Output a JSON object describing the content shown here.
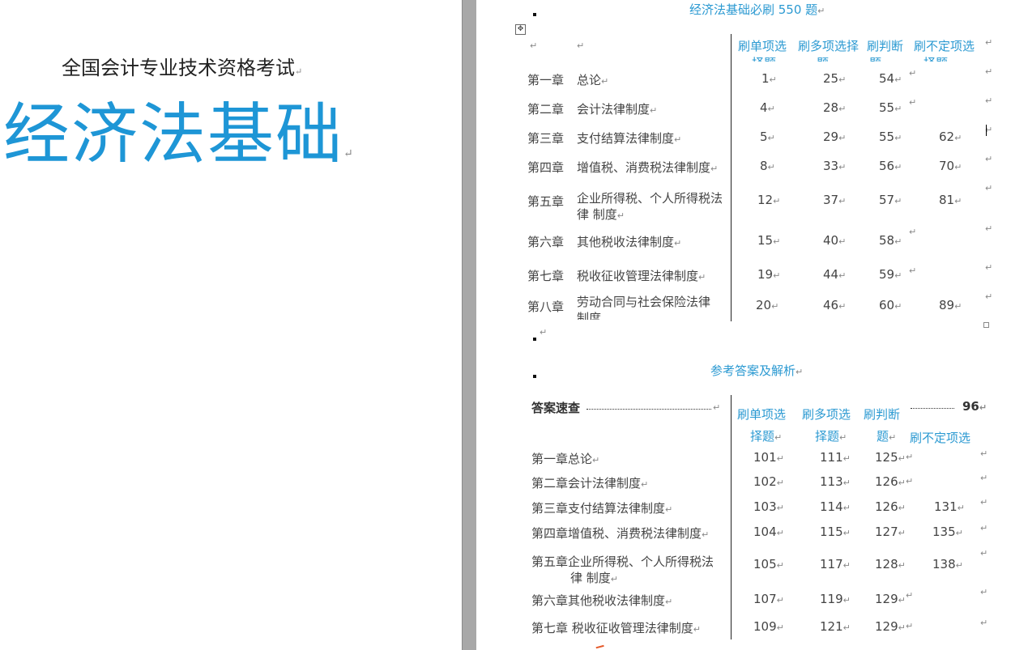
{
  "cover": {
    "subtitle": "全国会计专业技术资格考试",
    "title": "经济法基础"
  },
  "table1": {
    "title": "经济法基础必刷 550 题",
    "headers": [
      "刷单项选",
      "刷多项选择",
      "刷判断",
      "刷不定项选"
    ],
    "header_row2": [
      "择题",
      "题",
      "题",
      "择题"
    ],
    "rows": [
      {
        "chapter": "第一章",
        "name": "总论",
        "v1": "1",
        "v2": "25",
        "v3": "54",
        "v4": ""
      },
      {
        "chapter": "第二章",
        "name": "会计法律制度",
        "v1": "4",
        "v2": "28",
        "v3": "55",
        "v4": ""
      },
      {
        "chapter": "第三章",
        "name": "支付结算法律制度",
        "v1": "5",
        "v2": "29",
        "v3": "55",
        "v4": "62"
      },
      {
        "chapter": "第四章",
        "name": "增值税、消费税法律制度",
        "v1": "8",
        "v2": "33",
        "v3": "56",
        "v4": "70"
      },
      {
        "chapter": "第五章",
        "name": "企业所得税、个人所得税法",
        "name2": "律 制度",
        "v1": "12",
        "v2": "37",
        "v3": "57",
        "v4": "81"
      },
      {
        "chapter": "第六章",
        "name": "其他税收法律制度",
        "v1": "15",
        "v2": "40",
        "v3": "58",
        "v4": ""
      },
      {
        "chapter": "第七章",
        "name": "税收征收管理法律制度",
        "v1": "19",
        "v2": "44",
        "v3": "59",
        "v4": ""
      },
      {
        "chapter": "第八章",
        "name": "劳动合同与社会保险法律",
        "name2": "制度",
        "v1": "20",
        "v2": "46",
        "v3": "60",
        "v4": "89"
      }
    ]
  },
  "table2": {
    "title": "参考答案及解析",
    "quick_label": "答案速查",
    "quick_page": "96",
    "headers_row1": [
      "刷单项选",
      "刷多项选",
      "刷判断"
    ],
    "headers_row2": [
      "择题",
      "择题",
      "题"
    ],
    "header4": "刷不定项选",
    "rows": [
      {
        "name": "第一章总论",
        "v1": "101",
        "v2": "111",
        "v3": "125",
        "v4": ""
      },
      {
        "name": "第二章会计法律制度",
        "v1": "102",
        "v2": "113",
        "v3": "126",
        "v4": ""
      },
      {
        "name": "第三章支付结算法律制度",
        "v1": "103",
        "v2": "114",
        "v3": "126",
        "v4": "131"
      },
      {
        "name": "第四章增值税、消费税法律制度",
        "v1": "104",
        "v2": "115",
        "v3": "127",
        "v4": "135"
      },
      {
        "name": "第五章企业所得税、个人所得税法",
        "name2": "律 制度",
        "v1": "105",
        "v2": "117",
        "v3": "128",
        "v4": "138"
      },
      {
        "name": "第六章其他税收法律制度",
        "v1": "107",
        "v2": "119",
        "v3": "129",
        "v4": ""
      },
      {
        "name": "第七章 税收征收管理法律制度",
        "v1": "109",
        "v2": "121",
        "v3": "129",
        "v4": ""
      }
    ]
  },
  "colors": {
    "accent": "#2c9ad2",
    "title_blue": "#1e96d6",
    "gap": "#a8a8a8"
  }
}
